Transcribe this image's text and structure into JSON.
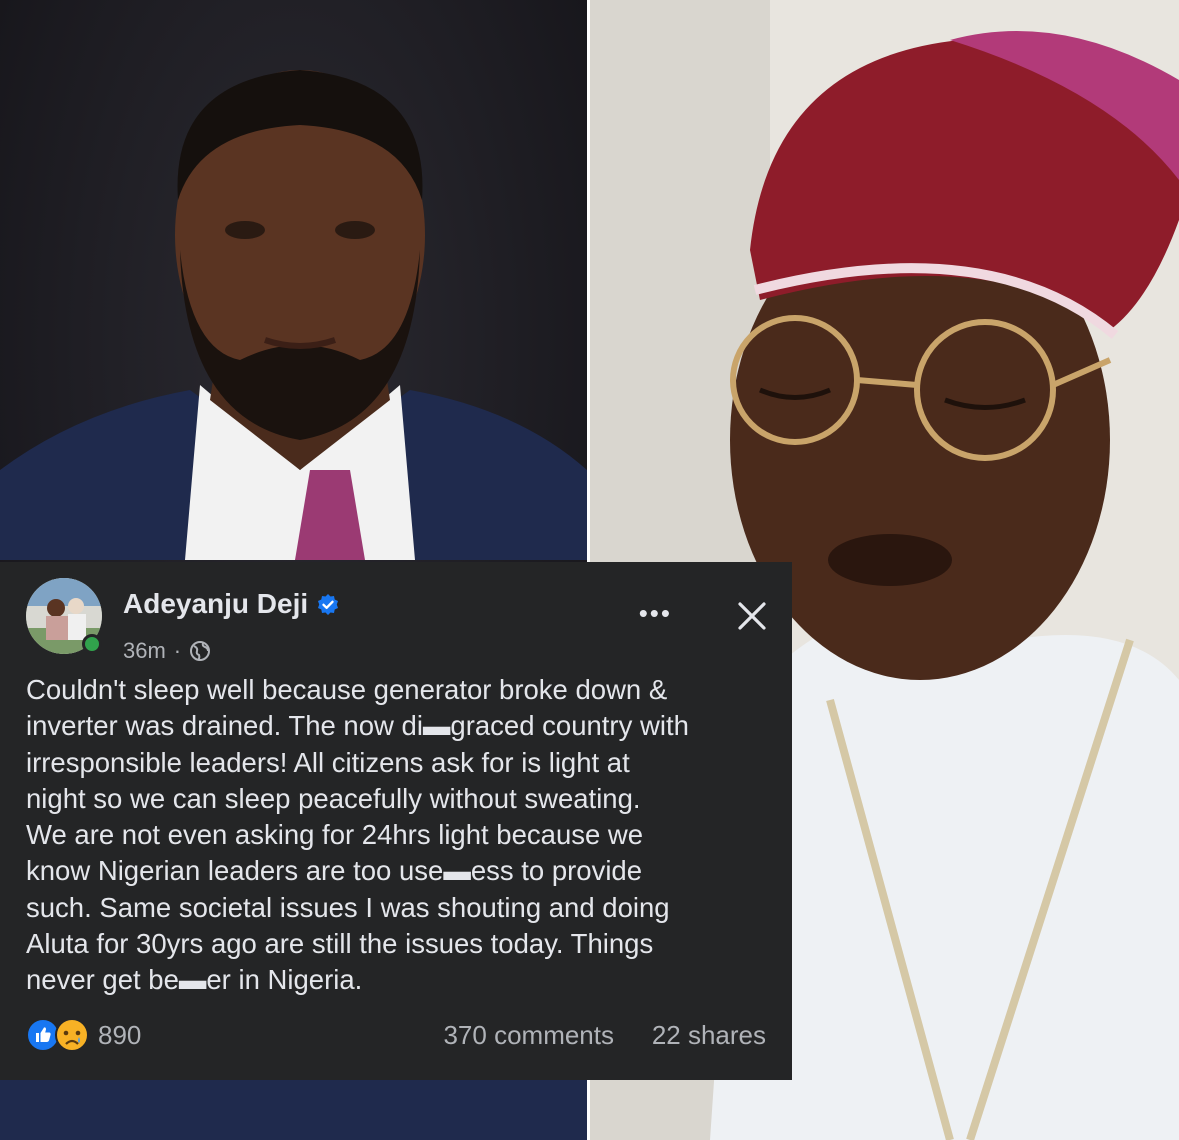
{
  "post": {
    "author": "Adeyanju Deji",
    "time": "36m",
    "separator": "·",
    "more_label": "•••",
    "body": "Couldn't sleep well because generator broke down &\ninverter was drained. The now di▬graced country with\nirresponsible leaders! All citizens ask for is light at\nnight so we can sleep peacefully without sweating.\nWe are not even asking for 24hrs light because we\nknow Nigerian leaders are too use▬ess to provide\nsuch. Same societal issues I was shouting and doing\nAluta for 30yrs ago are still the issues today. Things\nnever get be▬er in Nigeria.",
    "reaction_count": "890",
    "comments": "370 comments",
    "shares": "22 shares",
    "icons": {
      "verified": "verified-badge-icon",
      "privacy": "globe-icon",
      "close": "close-icon",
      "reactions": [
        "like-icon",
        "sad-icon"
      ]
    },
    "colors": {
      "card_bg": "#242526",
      "text": "#e4e6eb",
      "secondary": "#b0b3b8",
      "fb_blue": "#1877f2",
      "online_green": "#31a24c"
    }
  }
}
